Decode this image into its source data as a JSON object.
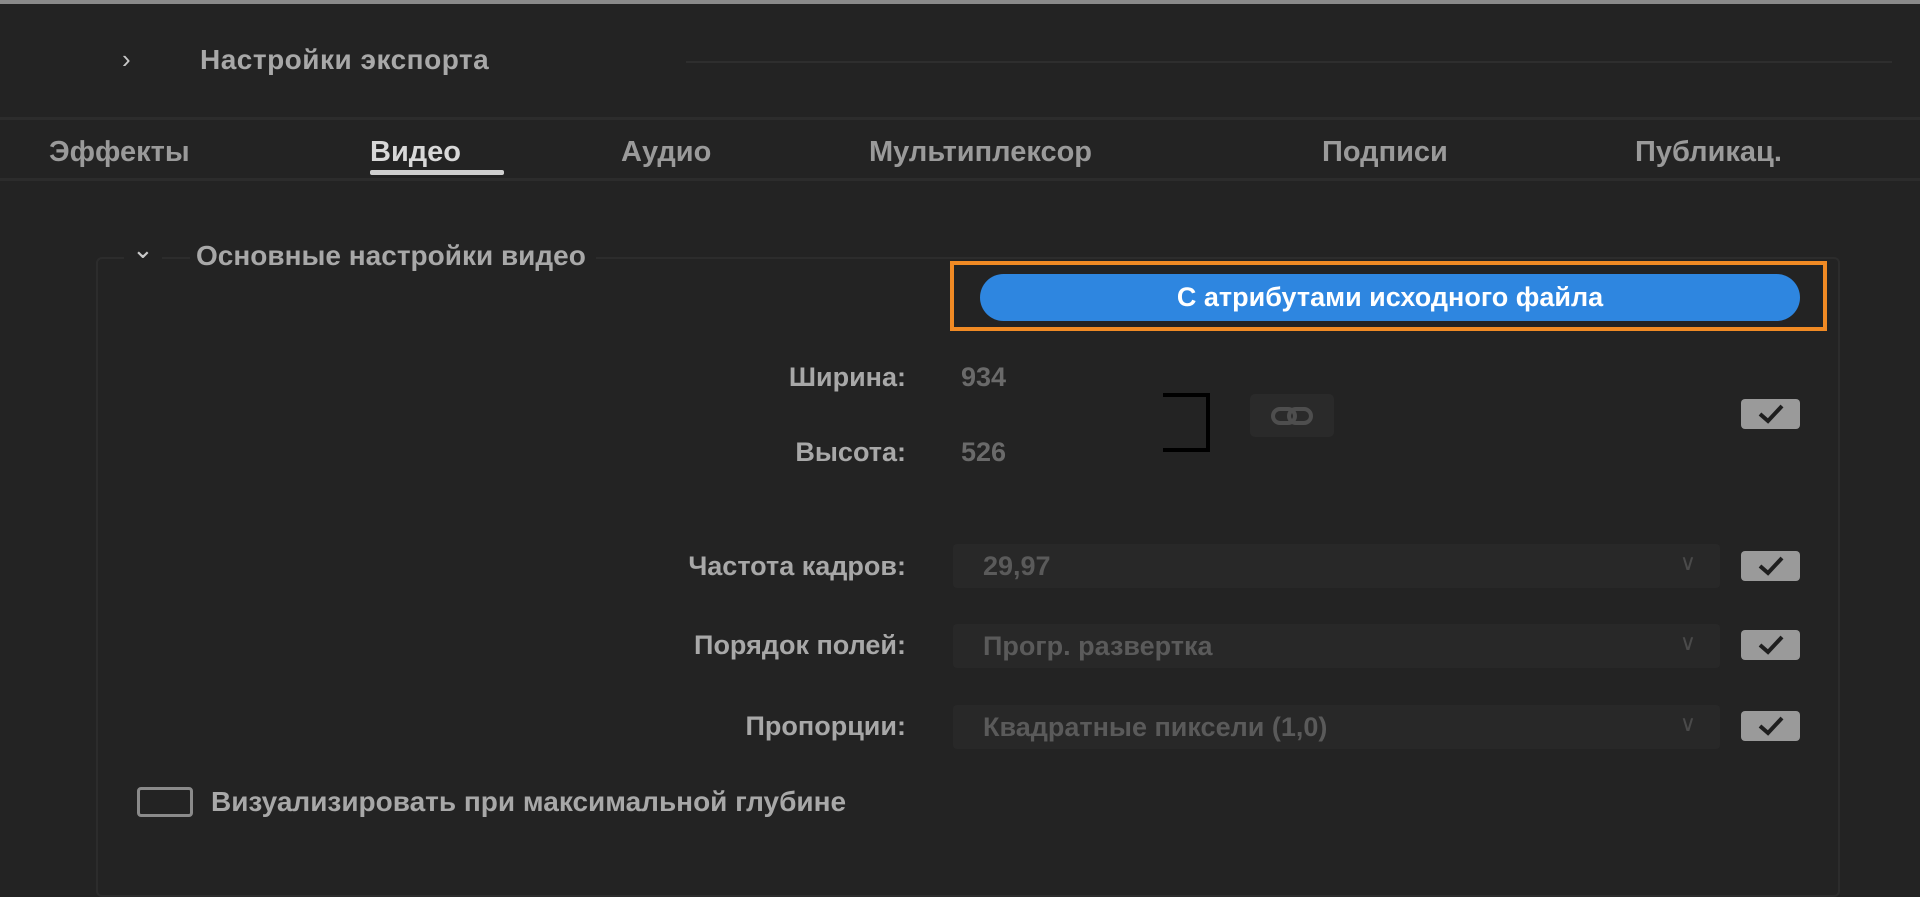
{
  "header": {
    "title": "Настройки экспорта",
    "chevron": "chevron-right-icon"
  },
  "tabs": [
    {
      "label": "Эффекты"
    },
    {
      "label": "Видео",
      "active": true
    },
    {
      "label": "Аудио"
    },
    {
      "label": "Мультиплексор"
    },
    {
      "label": "Подписи"
    },
    {
      "label": "Публикац."
    }
  ],
  "section": {
    "title": "Основные настройки видео",
    "match_source_label": "С атрибутами исходного файла",
    "width_label": "Ширина:",
    "width_value": "934",
    "height_label": "Высота:",
    "height_value": "526",
    "frame_rate_label": "Частота кадров:",
    "frame_rate_value": "29,97",
    "field_order_label": "Порядок полей:",
    "field_order_value": "Прогр. развертка",
    "aspect_label": "Пропорции:",
    "aspect_value": "Квадратные пиксели (1,0)",
    "max_depth_label": "Визуализировать при максимальной глубине"
  },
  "colors": {
    "accent": "#2e86e0",
    "highlight": "#f08a24",
    "background": "#232323"
  }
}
